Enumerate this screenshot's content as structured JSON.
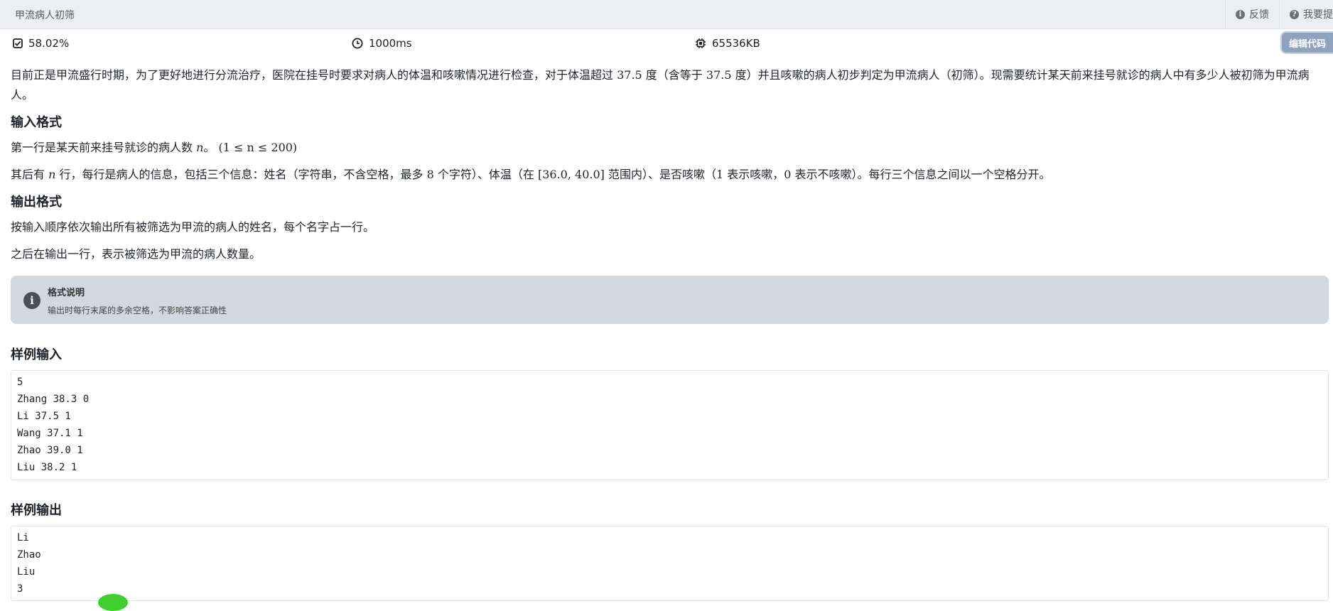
{
  "header": {
    "title": "甲流病人初筛",
    "feedback": "反馈",
    "action2": "我要提"
  },
  "stats": {
    "pass_rate": "58.02%",
    "time_limit": "1000ms",
    "memory_limit": "65536KB"
  },
  "edit_button": "编辑代码",
  "description": {
    "part1": "目前正是甲流盛行时期，为了更好地进行分流治疗，医院在挂号时要求对病人的体温和咳嗽情况进行检查，对于体温超过 ",
    "temp1": "37.5",
    "part2": " 度（含等于 ",
    "temp2": "37.5",
    "part3": " 度）并且咳嗽的病人初步判定为甲流病人（初筛）。现需要统计某天前来挂号就诊的病人中有多少人被初筛为甲流病",
    "part4": "人。"
  },
  "input_format": {
    "heading": "输入格式",
    "line1_text": "第一行是某天前来挂号就诊的病人数 ",
    "line1_var": "n",
    "line1_sep": "。 ",
    "line1_range": "(1 ≤ n ≤ 200)",
    "line2_a": "其后有 ",
    "line2_var": "n",
    "line2_b": " 行，每行是病人的信息，包括三个信息：姓名（字符串，不含空格，最多 ",
    "line2_max": "8",
    "line2_c": " 个字符）、体温（在 ",
    "line2_range": "[36.0, 40.0]",
    "line2_d": " 范围内）、是否咳嗽（",
    "line2_one": "1",
    "line2_e": " 表示咳嗽，",
    "line2_zero": "0",
    "line2_f": " 表示不咳嗽）。每行三个信息之间以一个空格分开。"
  },
  "output_format": {
    "heading": "输出格式",
    "line1": "按输入顺序依次输出所有被筛选为甲流的病人的姓名，每个名字占一行。",
    "line2": "之后在输出一行，表示被筛选为甲流的病人数量。"
  },
  "note": {
    "title": "格式说明",
    "text": "输出时每行末尾的多余空格，不影响答案正确性"
  },
  "sample_input": {
    "heading": "样例输入",
    "lines": [
      "5",
      "Zhang 38.3 0",
      "Li 37.5 1",
      "Wang 37.1 1",
      "Zhao 39.0 1",
      "Liu 38.2 1"
    ]
  },
  "sample_output": {
    "heading": "样例输出",
    "lines": [
      "Li",
      "Zhao",
      "Liu",
      "3"
    ]
  },
  "icons": {
    "pass": "checkbox-checked-icon",
    "time": "clock-icon",
    "memory": "chip-icon",
    "feedback": "info-icon",
    "help": "question-icon",
    "note": "info-icon"
  }
}
